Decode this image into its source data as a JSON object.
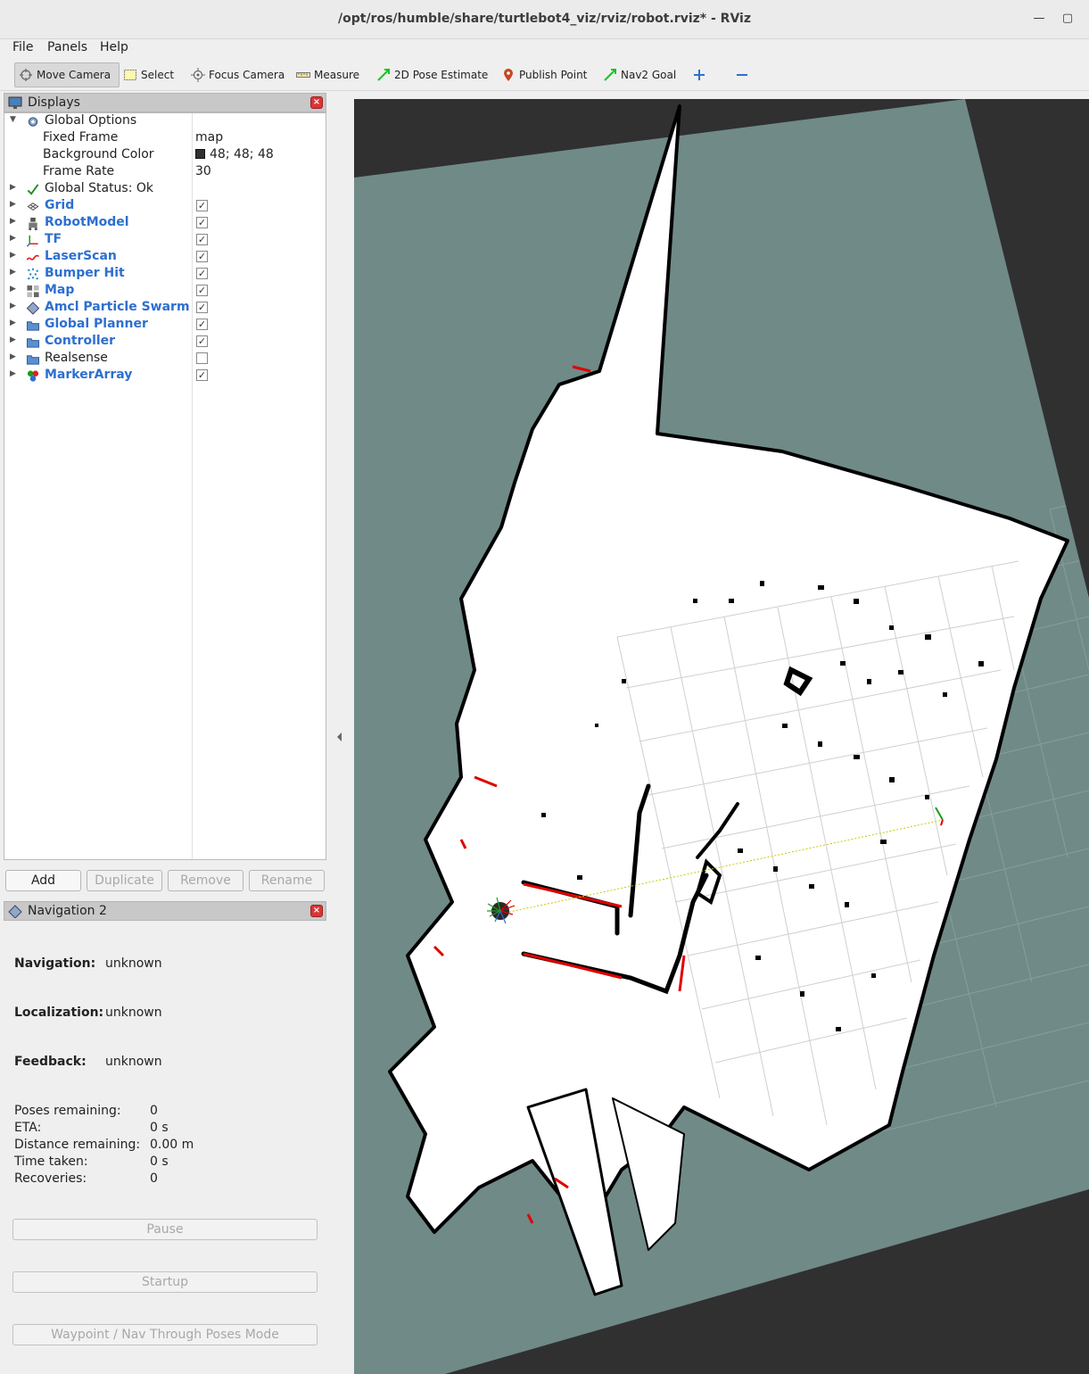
{
  "window": {
    "title": "/opt/ros/humble/share/turtlebot4_viz/rviz/robot.rviz* - RViz"
  },
  "menu": {
    "file": "File",
    "panels": "Panels",
    "help": "Help"
  },
  "toolbar": {
    "move_camera": "Move Camera",
    "select": "Select",
    "focus_camera": "Focus Camera",
    "measure": "Measure",
    "pose_estimate": "2D Pose Estimate",
    "publish_point": "Publish Point",
    "nav2_goal": "Nav2 Goal"
  },
  "displays": {
    "title": "Displays",
    "global_options": "Global Options",
    "fixed_frame_label": "Fixed Frame",
    "fixed_frame_value": "map",
    "background_color_label": "Background Color",
    "background_color_value": "48; 48; 48",
    "frame_rate_label": "Frame Rate",
    "frame_rate_value": "30",
    "global_status": "Global Status: Ok",
    "items": [
      {
        "label": "Grid",
        "checked": true
      },
      {
        "label": "RobotModel",
        "checked": true
      },
      {
        "label": "TF",
        "checked": true
      },
      {
        "label": "LaserScan",
        "checked": true
      },
      {
        "label": "Bumper Hit",
        "checked": true
      },
      {
        "label": "Map",
        "checked": true
      },
      {
        "label": "Amcl Particle Swarm",
        "checked": true
      },
      {
        "label": "Global Planner",
        "checked": true
      },
      {
        "label": "Controller",
        "checked": true
      },
      {
        "label": "Realsense",
        "checked": false
      },
      {
        "label": "MarkerArray",
        "checked": true
      }
    ],
    "buttons": {
      "add": "Add",
      "duplicate": "Duplicate",
      "remove": "Remove",
      "rename": "Rename"
    }
  },
  "navigation": {
    "title": "Navigation 2",
    "navigation_label": "Navigation:",
    "navigation_value": "unknown",
    "localization_label": "Localization:",
    "localization_value": "unknown",
    "feedback_label": "Feedback:",
    "feedback_value": "unknown",
    "poses_remaining_label": "Poses remaining:",
    "poses_remaining_value": "0",
    "eta_label": "ETA:",
    "eta_value": "0 s",
    "distance_label": "Distance remaining:",
    "distance_value": "0.00 m",
    "time_taken_label": "Time taken:",
    "time_taken_value": "0 s",
    "recoveries_label": "Recoveries:",
    "recoveries_value": "0",
    "pause": "Pause",
    "startup": "Startup",
    "waypoint_mode": "Waypoint / Nav Through Poses Mode"
  },
  "colors": {
    "background": "#303030",
    "map_unknown": "#708a88",
    "map_free": "#ffffff",
    "map_occupied": "#000000",
    "laser": "#e00000",
    "link_blue": "#2d6fd0"
  }
}
